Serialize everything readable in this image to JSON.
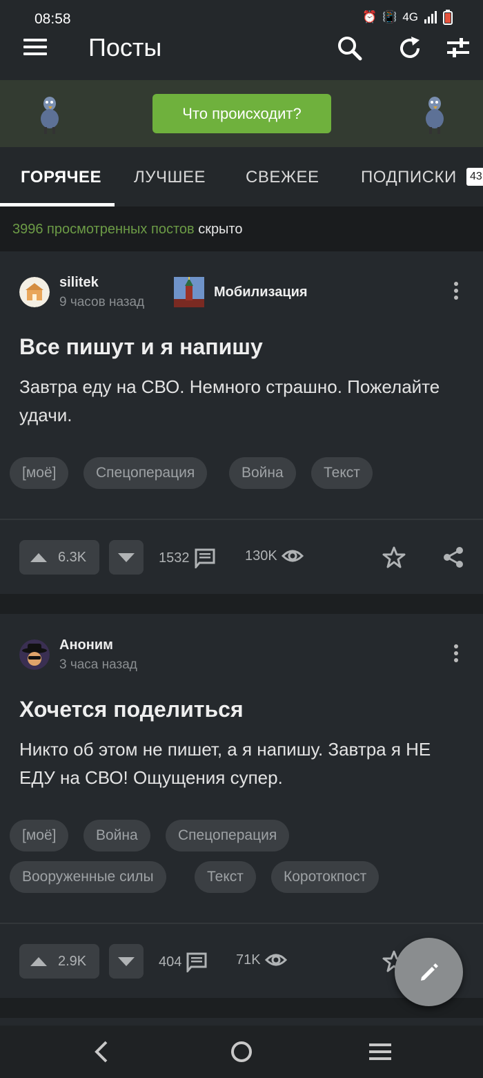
{
  "status": {
    "time": "08:58",
    "network": "4G"
  },
  "appbar": {
    "title": "Посты"
  },
  "banner": {
    "button_label": "Что происходит?"
  },
  "tabs": [
    {
      "label": "ГОРЯЧЕЕ",
      "active": true
    },
    {
      "label": "ЛУЧШЕЕ",
      "active": false
    },
    {
      "label": "СВЕЖЕЕ",
      "active": false
    },
    {
      "label": "ПОДПИСКИ",
      "active": false,
      "badge": "43"
    }
  ],
  "hidden_posts": {
    "count_text": "3996 просмотренных постов",
    "state": "скрыто"
  },
  "posts": [
    {
      "author": "silitek",
      "time_ago": "9 часов назад",
      "community": "Мобилизация",
      "title": "Все пишут и я напишу",
      "body": "Завтра еду на СВО. Немного страшно. Пожелайте удачи.",
      "tags": [
        "[моё]",
        "Спецоперация",
        "Война",
        "Текст"
      ],
      "rating": "6.3K",
      "comments": "1532",
      "views": "130K"
    },
    {
      "author": "Аноним",
      "time_ago": "3 часа назад",
      "title": "Хочется поделиться",
      "body": "Никто об этом не пишет, а я напишу. Завтра я НЕ ЕДУ на СВО! Ощущения супер.",
      "tags": [
        "[моё]",
        "Война",
        "Спецоперация",
        "Вооруженные силы",
        "Текст",
        "Коротокпост"
      ],
      "rating": "2.9K",
      "comments": "404",
      "views": "71K"
    }
  ],
  "colors": {
    "accent_green": "#6fb13d",
    "background": "#1c1f21",
    "card": "#25292d"
  }
}
